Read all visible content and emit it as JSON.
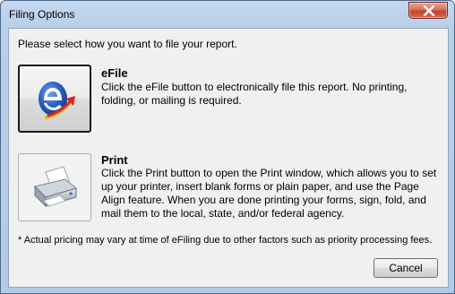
{
  "window": {
    "title": "Filing Options",
    "close_icon": "close-icon"
  },
  "dialog": {
    "prompt": "Please select how you want to file your report.",
    "options": [
      {
        "title": "eFile",
        "icon": "efile-icon",
        "description": "Click the eFile button to electronically file this report. No printing, folding, or mailing is required."
      },
      {
        "title": "Print",
        "icon": "printer-icon",
        "description": "Click the Print button to open the Print window, which allows you to set up your printer, insert blank forms or plain paper, and use the Page Align feature. When you are done printing your forms, sign, fold, and mail them to the local, state, and/or federal agency."
      }
    ],
    "footnote": "* Actual pricing may vary at time of eFiling due to other factors such as priority processing fees.",
    "cancel_label": "Cancel"
  },
  "colors": {
    "titlebar": "#b9cfe8",
    "client_bg": "#f0f0f0",
    "close_red": "#c3442d",
    "efile_blue": "#1f4fa8",
    "efile_arrow": "#d42a1c"
  }
}
